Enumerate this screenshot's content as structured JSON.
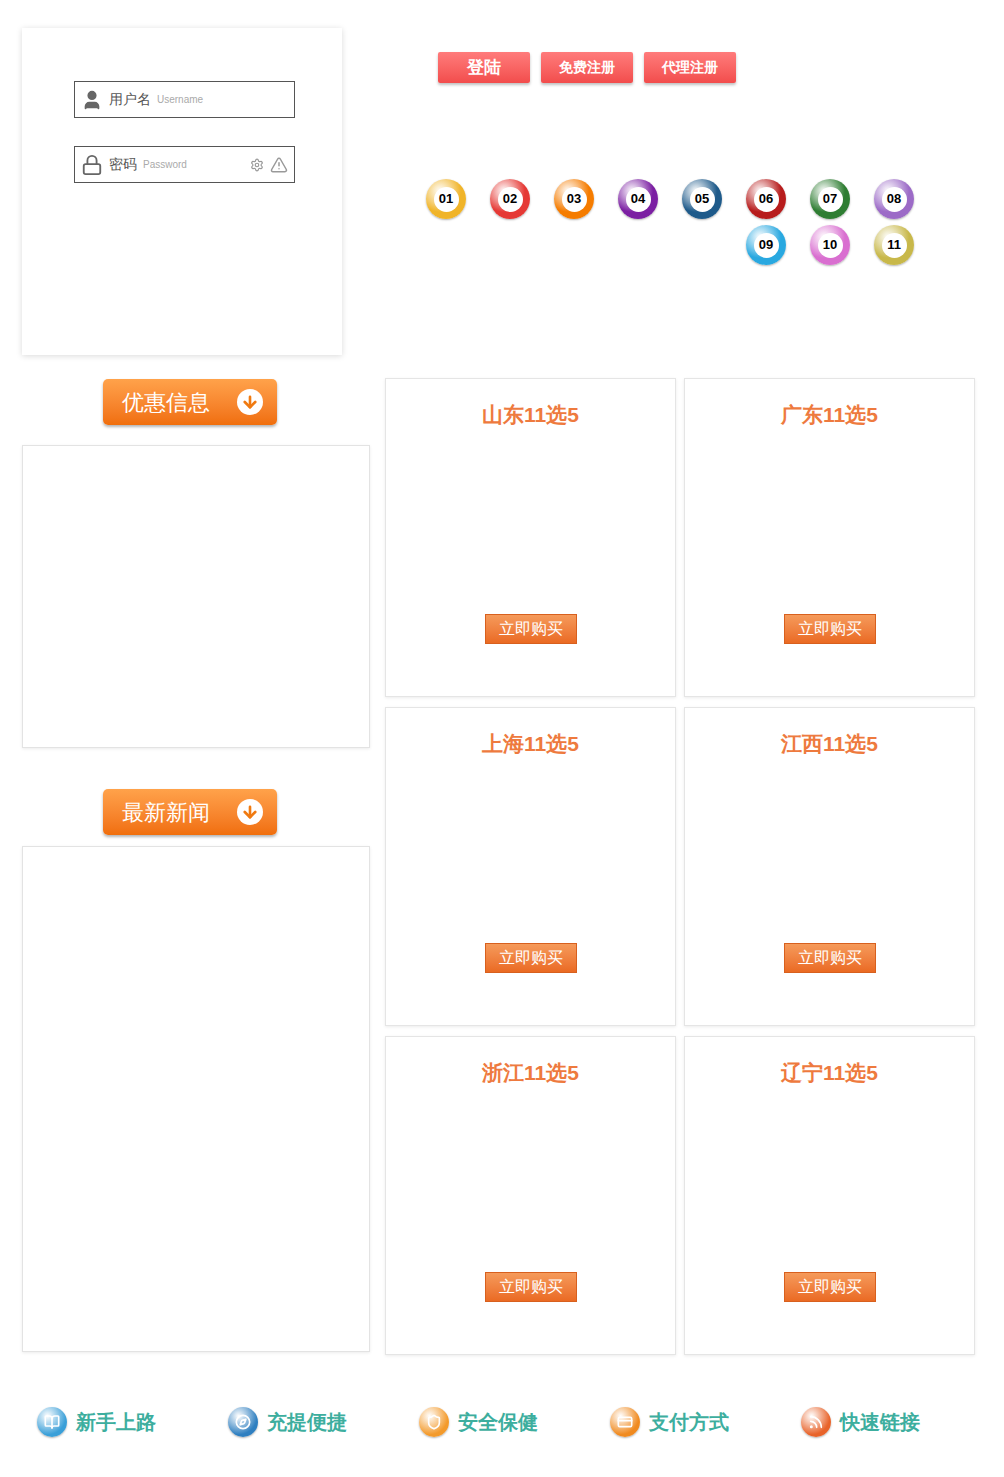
{
  "login": {
    "username": {
      "label": "用户名",
      "placeholder": "Username"
    },
    "password": {
      "label": "密码",
      "placeholder": "Password"
    }
  },
  "header_buttons": [
    "登陆",
    "免费注册",
    "代理注册"
  ],
  "balls": [
    {
      "number": "01",
      "color": "#f0b429"
    },
    {
      "number": "02",
      "color": "#e53935"
    },
    {
      "number": "03",
      "color": "#f57c00"
    },
    {
      "number": "04",
      "color": "#7b1fa2"
    },
    {
      "number": "05",
      "color": "#1e5a8a"
    },
    {
      "number": "06",
      "color": "#b71c1c"
    },
    {
      "number": "07",
      "color": "#2e7d32"
    },
    {
      "number": "08",
      "color": "#9c6bc7"
    },
    {
      "number": "09",
      "color": "#29a8e0"
    },
    {
      "number": "10",
      "color": "#d96fd0"
    },
    {
      "number": "11",
      "color": "#c8b84a"
    }
  ],
  "sidebar": {
    "sections": [
      {
        "title": "优惠信息"
      },
      {
        "title": "最新新闻"
      }
    ]
  },
  "lotteries": [
    {
      "title": "山东11选5",
      "button": "立即购买"
    },
    {
      "title": "广东11选5",
      "button": "立即购买"
    },
    {
      "title": "上海11选5",
      "button": "立即购买"
    },
    {
      "title": "江西11选5",
      "button": "立即购买"
    },
    {
      "title": "浙江11选5",
      "button": "立即购买"
    },
    {
      "title": "辽宁11选5",
      "button": "立即购买"
    }
  ],
  "footer_links": [
    {
      "label": "新手上路",
      "color": "#3a9fd8"
    },
    {
      "label": "充提便捷",
      "color": "#2f7fc0"
    },
    {
      "label": "安全保健",
      "color": "#f39a2b"
    },
    {
      "label": "支付方式",
      "color": "#f08a1f"
    },
    {
      "label": "快速链接",
      "color": "#e8632a"
    }
  ]
}
